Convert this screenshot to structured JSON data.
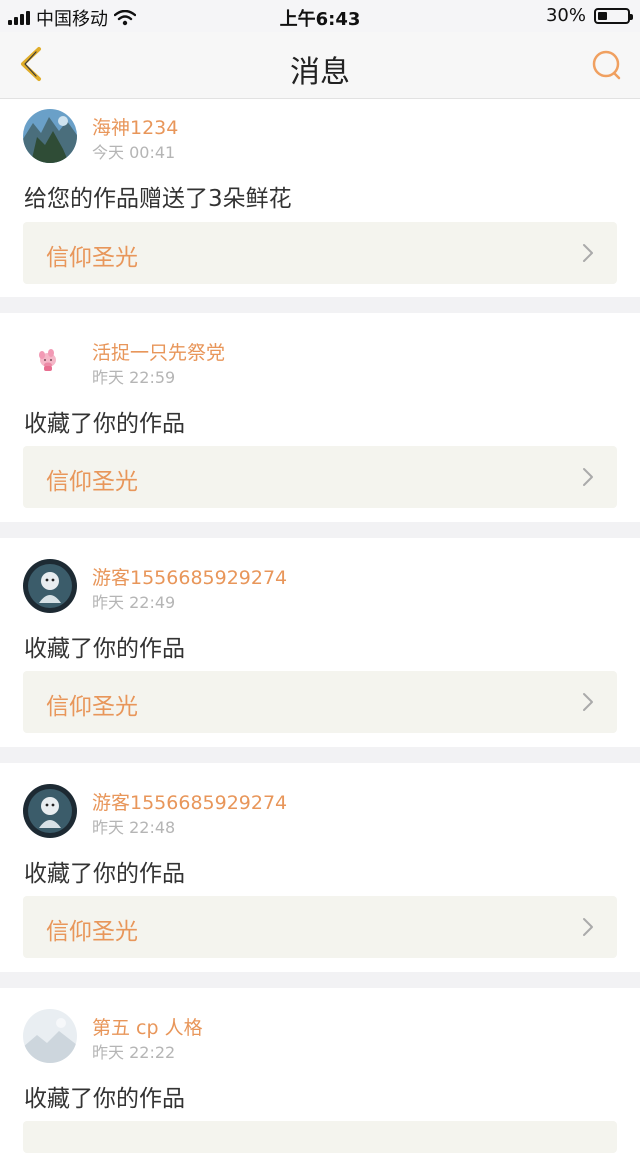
{
  "status_bar": {
    "carrier": "中国移动",
    "time": "上午6:43",
    "battery": "30%",
    "battery_level": 0.3
  },
  "header": {
    "title": "消息"
  },
  "colors": {
    "accent": "#e8965a",
    "card_bg": "#f4f4ee",
    "separator": "#f2f2f4"
  },
  "messages": [
    {
      "username": "海神1234",
      "time": "今天 00:41",
      "action": "给您的作品赠送了3朵鲜花",
      "work_title": "信仰圣光",
      "avatar": "landscape-avatar"
    },
    {
      "username": "活捉一只先祭党",
      "time": "昨天 22:59",
      "action": "收藏了你的作品",
      "work_title": "信仰圣光",
      "avatar": "pig-avatar"
    },
    {
      "username": "游客1556685929274",
      "time": "昨天 22:49",
      "action": "收藏了你的作品",
      "work_title": "信仰圣光",
      "avatar": "dark-character-avatar"
    },
    {
      "username": "游客1556685929274",
      "time": "昨天 22:48",
      "action": "收藏了你的作品",
      "work_title": "信仰圣光",
      "avatar": "dark-character-avatar"
    },
    {
      "username": "第五 cp 人格",
      "time": "昨天 22:22",
      "action": "收藏了你的作品",
      "work_title": "",
      "avatar": "pale-landscape-avatar"
    }
  ]
}
